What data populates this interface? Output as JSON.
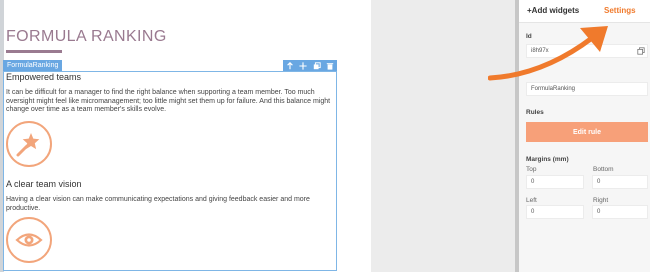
{
  "canvas": {
    "page_title": "FORMULA RANKING",
    "widget_tag": "FormulaRanking",
    "sections": [
      {
        "heading": "Empowered teams",
        "text": "It can be difficult for a manager to find the right balance when supporting a team member. Too much oversight might feel like micromanagement; too little might set them up for failure. And this balance might change over time as a team member's skills evolve.",
        "icon": "shooting-star-icon"
      },
      {
        "heading": "A clear team vision",
        "text": "Having a clear vision can make communicating expectations and giving feedback easier and more productive.",
        "icon": "eye-icon"
      }
    ]
  },
  "toolbar": {
    "add_widgets": "+Add widgets",
    "settings": "Settings"
  },
  "settings_panel": {
    "id_label": "Id",
    "id_value": "i8h97x",
    "name_value": "FormulaRanking",
    "rules_label": "Rules",
    "edit_rule_label": "Edit rule",
    "margins_label": "Margins (mm)",
    "top_label": "Top",
    "top_value": "0",
    "bottom_label": "Bottom",
    "bottom_value": "0",
    "left_label": "Left",
    "left_value": "0",
    "right_label": "Right",
    "right_value": "0"
  },
  "colors": {
    "accent": "#f07a2c",
    "button": "#f7a079",
    "title": "#9a7a90",
    "selection": "#69a7e2"
  }
}
